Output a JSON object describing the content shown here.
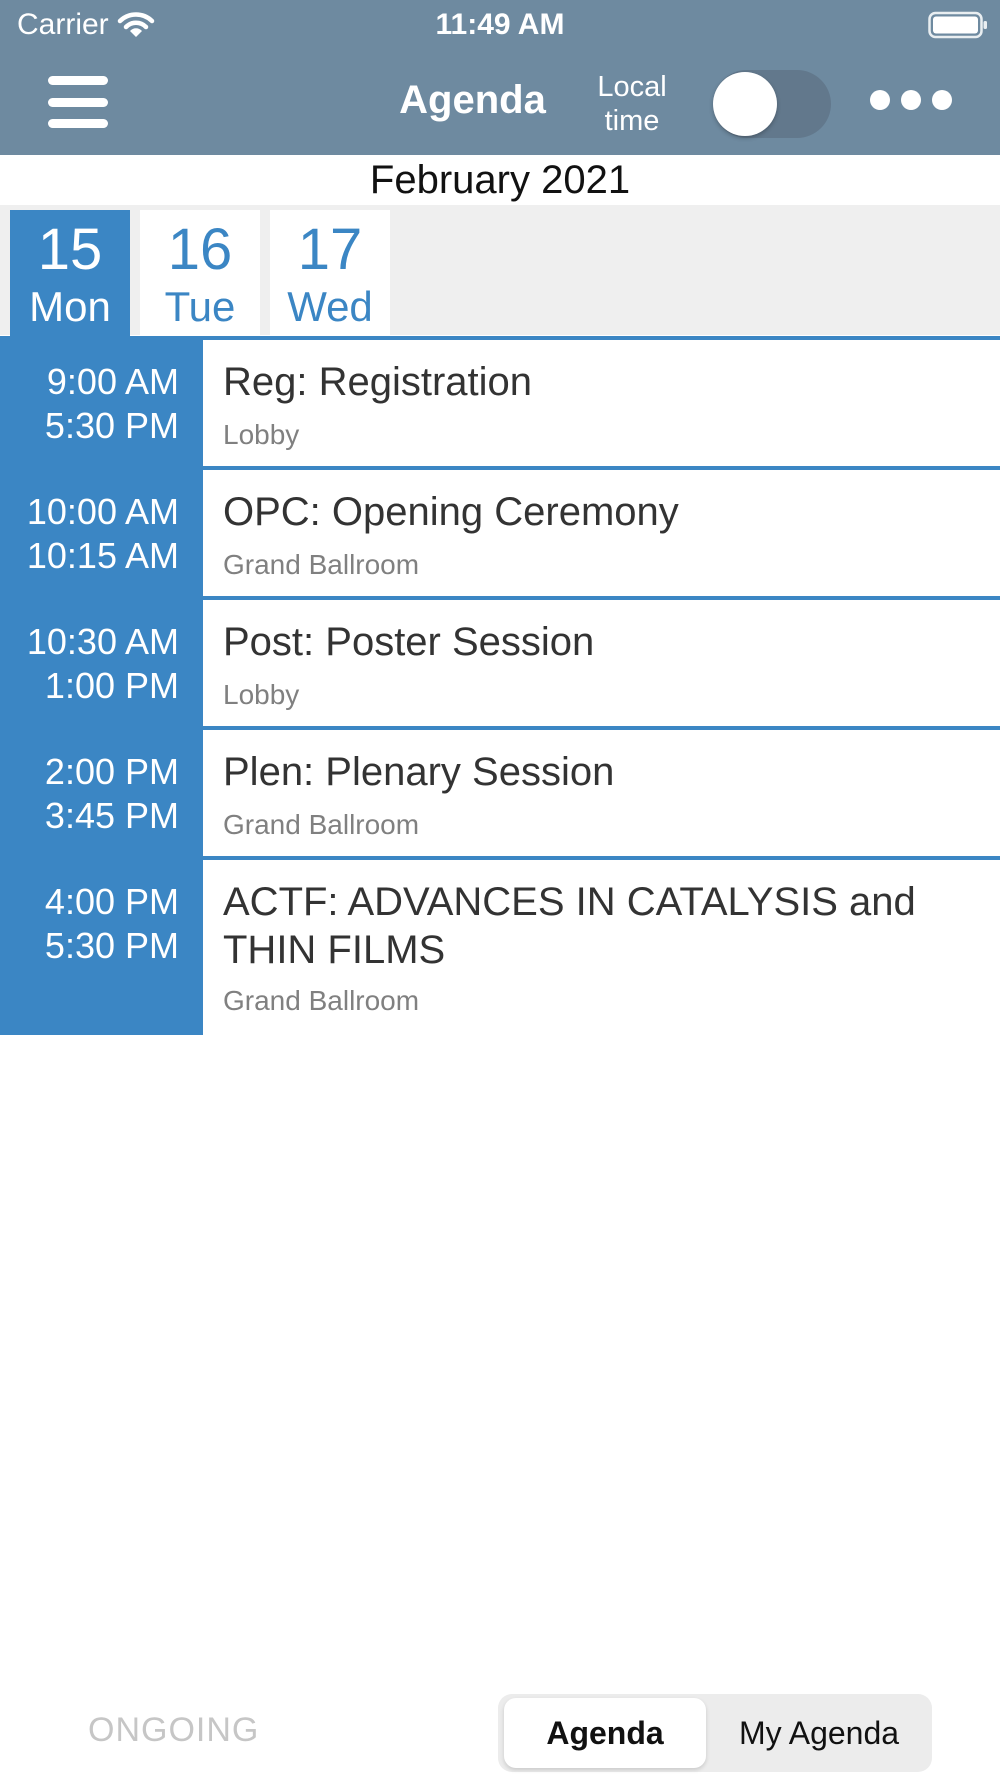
{
  "status_bar": {
    "carrier": "Carrier",
    "time": "11:49 AM"
  },
  "nav": {
    "title": "Agenda",
    "local_time_label": "Local time",
    "local_time_toggle_on": false
  },
  "month": "February 2021",
  "days": [
    {
      "num": "15",
      "name": "Mon",
      "selected": true
    },
    {
      "num": "16",
      "name": "Tue",
      "selected": false
    },
    {
      "num": "17",
      "name": "Wed",
      "selected": false
    }
  ],
  "sessions": [
    {
      "start": "9:00 AM",
      "end": "5:30 PM",
      "title": "Reg: Registration",
      "location": "Lobby"
    },
    {
      "start": "10:00 AM",
      "end": "10:15 AM",
      "title": "OPC: Opening Ceremony",
      "location": "Grand Ballroom"
    },
    {
      "start": "10:30 AM",
      "end": "1:00 PM",
      "title": "Post: Poster Session",
      "location": "Lobby"
    },
    {
      "start": "2:00 PM",
      "end": "3:45 PM",
      "title": "Plen: Plenary Session",
      "location": "Grand Ballroom"
    },
    {
      "start": "4:00 PM",
      "end": "5:30 PM",
      "title": "ACTF: ADVANCES IN CATALYSIS and THIN FILMS",
      "location": "Grand Ballroom"
    }
  ],
  "bottom": {
    "ongoing": "ONGOING",
    "segments": [
      "Agenda",
      "My Agenda"
    ],
    "selected_segment": "Agenda"
  },
  "colors": {
    "nav_bar": "#6e8aa0",
    "accent": "#3b86c4"
  },
  "icons": {
    "menu": "hamburger-menu-icon",
    "more": "more-dots-icon",
    "wifi": "wifi-icon",
    "battery": "battery-icon"
  }
}
